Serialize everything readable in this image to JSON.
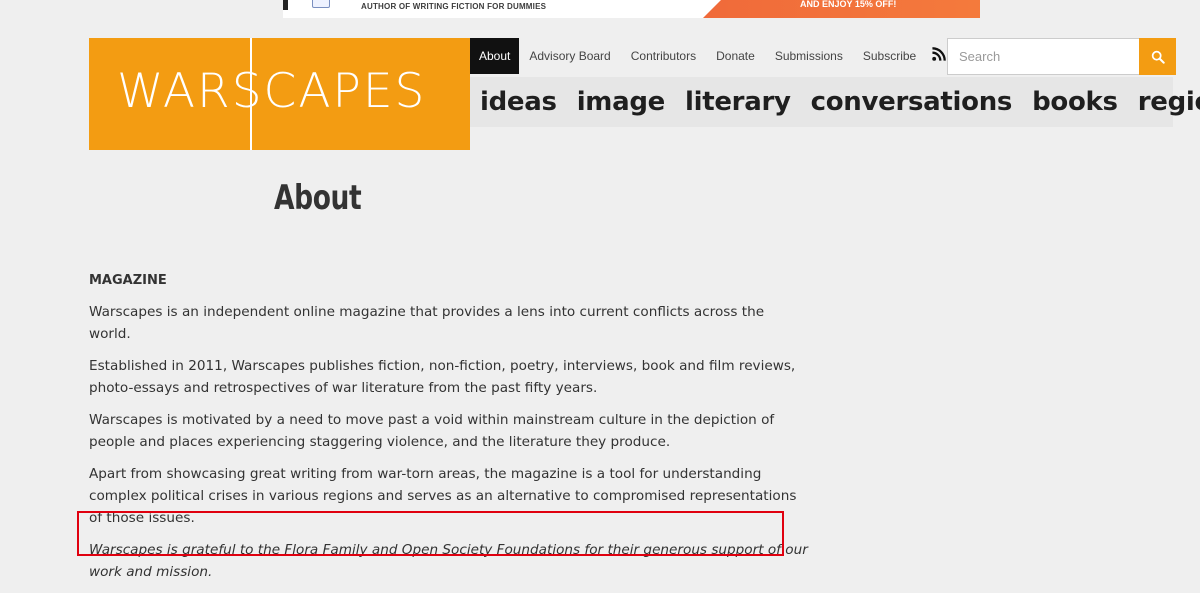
{
  "ad": {
    "text": "AUTHOR OF WRITING FICTION FOR DUMMIES",
    "cta": "AND ENJOY 15% OFF!"
  },
  "logo": {
    "text": "WARSCAPES"
  },
  "nav": {
    "items": [
      {
        "label": "About",
        "active": true
      },
      {
        "label": "Advisory Board"
      },
      {
        "label": "Contributors"
      },
      {
        "label": "Donate"
      },
      {
        "label": "Submissions"
      },
      {
        "label": "Subscribe"
      }
    ],
    "rss_icon": "rss-icon"
  },
  "search": {
    "placeholder": "Search",
    "button_icon": "search-icon"
  },
  "categories": [
    "ideas",
    "image",
    "literary",
    "conversations",
    "books",
    "region"
  ],
  "page": {
    "title": "About"
  },
  "content": {
    "heading": "MAGAZINE",
    "paragraphs": [
      "Warscapes is an independent online magazine that provides a lens into current conflicts across the world.",
      "Established in 2011, Warscapes publishes fiction, non-fiction, poetry, interviews, book and film reviews, photo-essays and retrospectives of war literature from the past fifty years.",
      "Warscapes is motivated by a need to move past a void within mainstream culture in the depiction of people and places experiencing staggering violence, and the literature they produce.",
      "Apart from showcasing great writing from war-torn areas, the magazine is a tool for understanding complex political crises in various regions and serves as an alternative to compromised representations of those issues."
    ],
    "acknowledgement": "Warscapes is grateful to the Flora Family and Open Society Foundations for their generous support of our work and mission."
  },
  "colors": {
    "brand_orange": "#f39c12",
    "highlight_red": "#e0000f",
    "background": "#efefef"
  }
}
